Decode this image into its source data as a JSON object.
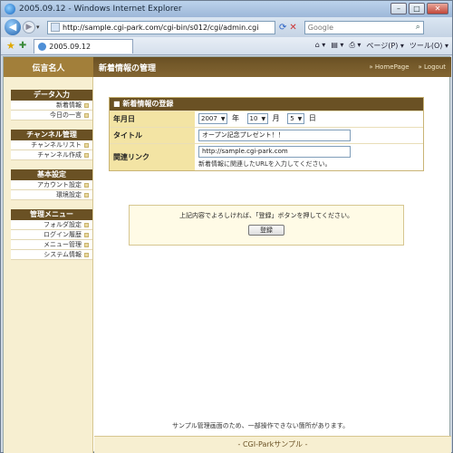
{
  "window": {
    "title": "2005.09.12 - Windows Internet Explorer",
    "minimize": "–",
    "maximize": "□",
    "close": "✕"
  },
  "addressbar": {
    "url": "http://sample.cgi-park.com/cgi-bin/s012/cgi/admin.cgi",
    "search_placeholder": "Google"
  },
  "tabbar": {
    "tab_label": "2005.09.12",
    "page_menu": "ページ(P) ▾",
    "tools_menu": "ツール(O) ▾"
  },
  "site": {
    "logo": "伝言名人",
    "page_title": "新着情報の管理",
    "link_home": "HomePage",
    "link_logout": "Logout"
  },
  "sidebar": {
    "sections": [
      {
        "title": "データ入力",
        "items": [
          "新着情報",
          "今日の一言"
        ]
      },
      {
        "title": "チャンネル管理",
        "items": [
          "チャンネルリスト",
          "チャンネル作成"
        ]
      },
      {
        "title": "基本設定",
        "items": [
          "アカウント設定",
          "環境設定"
        ]
      },
      {
        "title": "管理メニュー",
        "items": [
          "フォルダ設定",
          "ログイン履歴",
          "メニュー管理",
          "システム情報"
        ]
      }
    ]
  },
  "form": {
    "heading": "新着情報の登録",
    "date_label": "年月日",
    "year": "2007",
    "year_unit": "年",
    "month": "10",
    "month_unit": "月",
    "day": "5",
    "day_unit": "日",
    "title_label": "タイトル",
    "title_value": "オープン記念プレゼント！！",
    "link_label": "関連リンク",
    "link_value": "http://sample.cgi-park.com",
    "link_hint": "新着情報に関連したURLを入力してください。"
  },
  "confirm": {
    "message": "上記内容でよろしければ、「登録」ボタンを押してください。",
    "button": "登録"
  },
  "notice": "サンプル管理画面のため、一部操作できない箇所があります。",
  "footer": "- CGI-Parkサンプル -"
}
